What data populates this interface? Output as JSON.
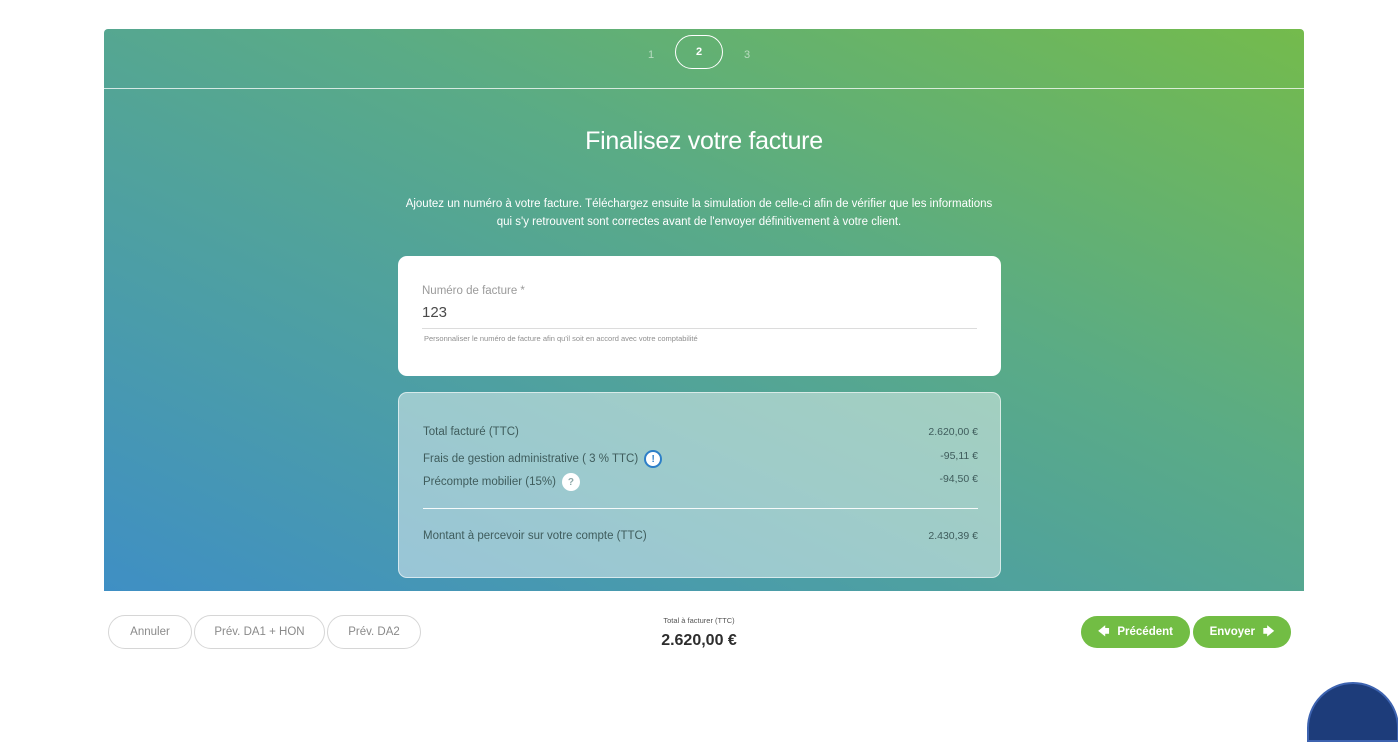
{
  "stepper": {
    "steps": [
      "1",
      "2",
      "3"
    ],
    "active": "2"
  },
  "header": {
    "title": "Finalisez votre facture",
    "description_line1": "Ajoutez un numéro à votre facture. Téléchargez ensuite la simulation de celle-ci afin de vérifier que les informations",
    "description_line2": "qui s'y retrouvent sont correctes avant de l'envoyer définitivement à votre client."
  },
  "invoice_number": {
    "label": "Numéro de facture *",
    "value": "123",
    "help": "Personnaliser le numéro de facture afin qu'il soit en accord avec votre comptabilité"
  },
  "summary": {
    "rows": [
      {
        "label": "Total facturé (TTC)",
        "value": "2.620,00 €"
      },
      {
        "label": "Frais de gestion administrative ( 3 % TTC)",
        "value": "-95,11 €",
        "icon": "info-icon"
      },
      {
        "label": "Précompte mobilier (15%)",
        "value": "-94,50 €",
        "icon": "help-icon"
      }
    ],
    "total": {
      "label": "Montant à percevoir sur votre compte (TTC)",
      "value": "2.430,39 €"
    }
  },
  "footer": {
    "cancel_label": "Annuler",
    "prev_da1_label": "Prév. DA1 + HON",
    "prev_da2_label": "Prév. DA2",
    "total_label": "Total à facturer (TTC)",
    "total_value": "2.620,00 €",
    "precedent_label": "Précédent",
    "envoyer_label": "Envoyer"
  },
  "colors": {
    "primary_green": "#72bd44",
    "info_blue": "#2d7fc8",
    "chat_navy": "#1d3c7a"
  }
}
